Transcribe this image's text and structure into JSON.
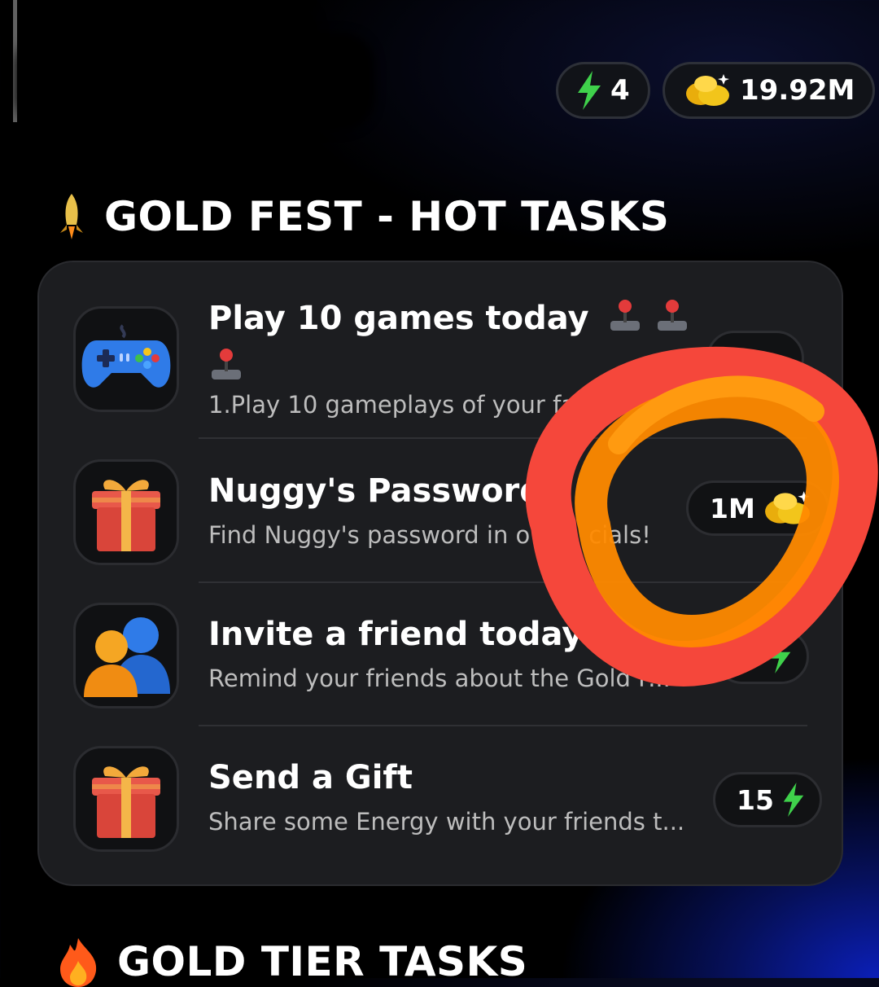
{
  "header": {
    "energy_value": "4",
    "gold_value": "19.92M"
  },
  "hot_section": {
    "title": "GOLD FEST - HOT TASKS"
  },
  "tasks": [
    {
      "title": "Play 10 games today",
      "title_emoji_line2": "🕹️",
      "description": "1.Play 10 gameplays of your fa",
      "icon": "gamepad-icon",
      "reward_value": "",
      "reward_icon": ""
    },
    {
      "title": "Nuggy's Password",
      "description_a": "Find Nuggy's password in o",
      "description_b": "cials!",
      "icon": "gift-icon",
      "reward_value": "1M",
      "reward_icon": "gold-nugget-icon"
    },
    {
      "title": "Invite a friend today",
      "description": "Remind your friends about the Gold F...",
      "icon": "friends-icon",
      "reward_value": "",
      "reward_icon": "lightning-icon"
    },
    {
      "title": "Send a Gift",
      "description": "Share some Energy with your friends t...",
      "icon": "gift-icon",
      "reward_value": "15",
      "reward_icon": "lightning-icon"
    }
  ],
  "tier_section": {
    "title": "GOLD TIER TASKS"
  },
  "colors": {
    "energy_green": "#3fd14b",
    "gold": "#f2c51b",
    "annotation_red": "#f5473b",
    "annotation_orange": "#ff8a00"
  }
}
